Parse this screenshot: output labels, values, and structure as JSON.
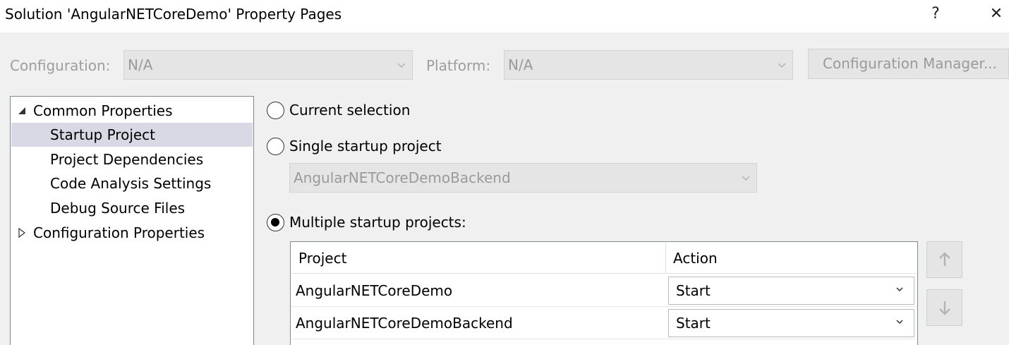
{
  "window": {
    "title": "Solution 'AngularNETCoreDemo' Property Pages",
    "help_glyph": "?",
    "close_glyph": "✕"
  },
  "config": {
    "configuration_label": "Configuration:",
    "configuration_value": "N/A",
    "platform_label": "Platform:",
    "platform_value": "N/A",
    "manager_button": "Configuration Manager..."
  },
  "tree": {
    "items": [
      {
        "label": "Common Properties",
        "arrow": "◢",
        "expanded": true
      },
      {
        "label": "Startup Project",
        "selected": true
      },
      {
        "label": "Project Dependencies"
      },
      {
        "label": "Code Analysis Settings"
      },
      {
        "label": "Debug Source Files"
      },
      {
        "label": "Configuration Properties",
        "arrow": "▷",
        "expanded": false
      }
    ]
  },
  "startup": {
    "current_selection_label": "Current selection",
    "single_startup_label": "Single startup project",
    "single_startup_value": "AngularNETCoreDemoBackend",
    "multiple_startup_label": "Multiple startup projects:",
    "selected_option": "multiple"
  },
  "grid": {
    "columns": [
      "Project",
      "Action"
    ],
    "rows": [
      {
        "project": "AngularNETCoreDemo",
        "action": "Start"
      },
      {
        "project": "AngularNETCoreDemoBackend",
        "action": "Start"
      }
    ]
  },
  "icons": {
    "chevron_down": "⌄",
    "move_up": "🡑",
    "move_down": "🡓"
  }
}
